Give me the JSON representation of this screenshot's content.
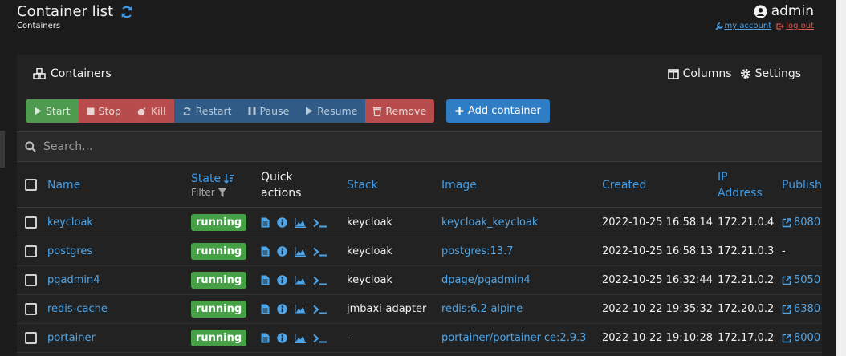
{
  "header": {
    "title": "Container list",
    "breadcrumb": "Containers",
    "username": "admin",
    "my_account": "my account",
    "log_out": "log out"
  },
  "panel": {
    "title": "Containers",
    "columns_label": "Columns",
    "settings_label": "Settings"
  },
  "actions": {
    "start": "Start",
    "stop": "Stop",
    "kill": "Kill",
    "restart": "Restart",
    "pause": "Pause",
    "resume": "Resume",
    "remove": "Remove",
    "add": "Add container"
  },
  "search": {
    "placeholder": "Search..."
  },
  "columns": {
    "name": "Name",
    "state": "State",
    "state_filter": "Filter",
    "quick_actions_1": "Quick",
    "quick_actions_2": "actions",
    "stack": "Stack",
    "image": "Image",
    "created": "Created",
    "ip_1": "IP",
    "ip_2": "Address",
    "published": "Publish"
  },
  "rows": [
    {
      "name": "keycloak",
      "state": "running",
      "stack": "keycloak",
      "image": "keycloak_keycloak",
      "created": "2022-10-25 16:58:14",
      "ip": "172.21.0.4",
      "port": "8080"
    },
    {
      "name": "postgres",
      "state": "running",
      "stack": "keycloak",
      "image": "postgres:13.7",
      "created": "2022-10-25 16:58:13",
      "ip": "172.21.0.3",
      "port": "-"
    },
    {
      "name": "pgadmin4",
      "state": "running",
      "stack": "keycloak",
      "image": "dpage/pgadmin4",
      "created": "2022-10-25 16:32:44",
      "ip": "172.21.0.2",
      "port": "5050"
    },
    {
      "name": "redis-cache",
      "state": "running",
      "stack": "jmbaxi-adapter",
      "image": "redis:6.2-alpine",
      "created": "2022-10-22 19:35:32",
      "ip": "172.20.0.2",
      "port": "6380"
    },
    {
      "name": "portainer",
      "state": "running",
      "stack": "-",
      "image": "portainer/portainer-ce:2.9.3",
      "created": "2022-10-22 19:10:28",
      "ip": "172.17.0.2",
      "port": "8000"
    }
  ],
  "colors": {
    "link": "#4ea6ea",
    "running": "#46a046",
    "danger": "#b84b4b",
    "primary": "#2f7dc4"
  }
}
